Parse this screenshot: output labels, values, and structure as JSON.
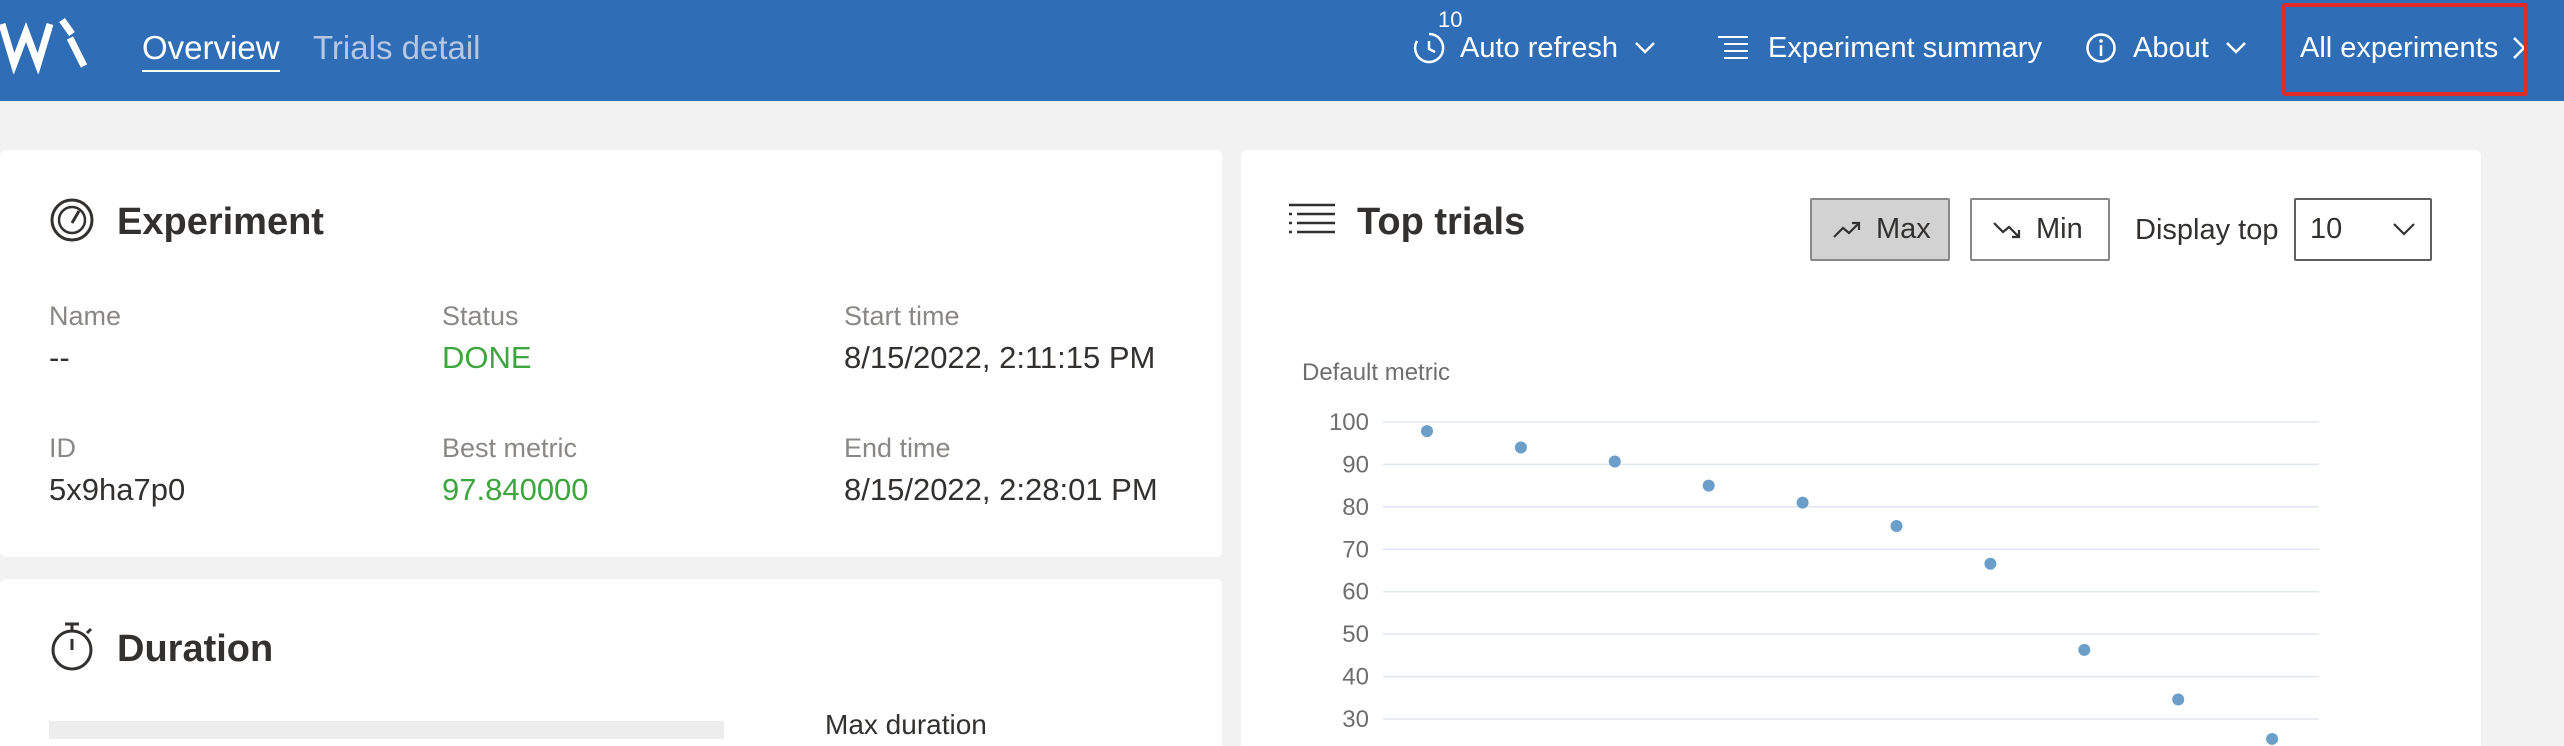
{
  "header": {
    "tabs": [
      {
        "label": "Overview",
        "active": true
      },
      {
        "label": "Trials detail",
        "active": false
      }
    ],
    "auto_refresh": {
      "label": "Auto refresh",
      "interval": "10"
    },
    "summary_label": "Experiment summary",
    "about_label": "About",
    "all_experiments_label": "All experiments",
    "accent_color": "#2f6db7"
  },
  "experiment": {
    "title": "Experiment",
    "name_label": "Name",
    "name_value": "--",
    "status_label": "Status",
    "status_value": "DONE",
    "start_label": "Start time",
    "start_value": "8/15/2022, 2:11:15 PM",
    "id_label": "ID",
    "id_value": "5x9ha7p0",
    "best_label": "Best metric",
    "best_value": "97.840000",
    "end_label": "End time",
    "end_value": "8/15/2022, 2:28:01 PM"
  },
  "duration": {
    "title": "Duration",
    "max_label": "Max duration"
  },
  "top_trials": {
    "title": "Top trials",
    "max_label": "Max",
    "min_label": "Min",
    "display_top_label": "Display top",
    "display_top_value": "10"
  },
  "chart_data": {
    "type": "scatter",
    "ylabel": "Default metric",
    "xlabel": "",
    "yticks": [
      30,
      40,
      50,
      60,
      70,
      80,
      90,
      100
    ],
    "ylim": [
      26,
      100
    ],
    "x": [
      1,
      2,
      3,
      4,
      5,
      6,
      7,
      8,
      9,
      10
    ],
    "values": [
      97.84,
      94.0,
      90.7,
      85.0,
      81.0,
      75.5,
      66.6,
      46.3,
      34.6,
      25.3
    ],
    "color": "#6b9ec9"
  }
}
